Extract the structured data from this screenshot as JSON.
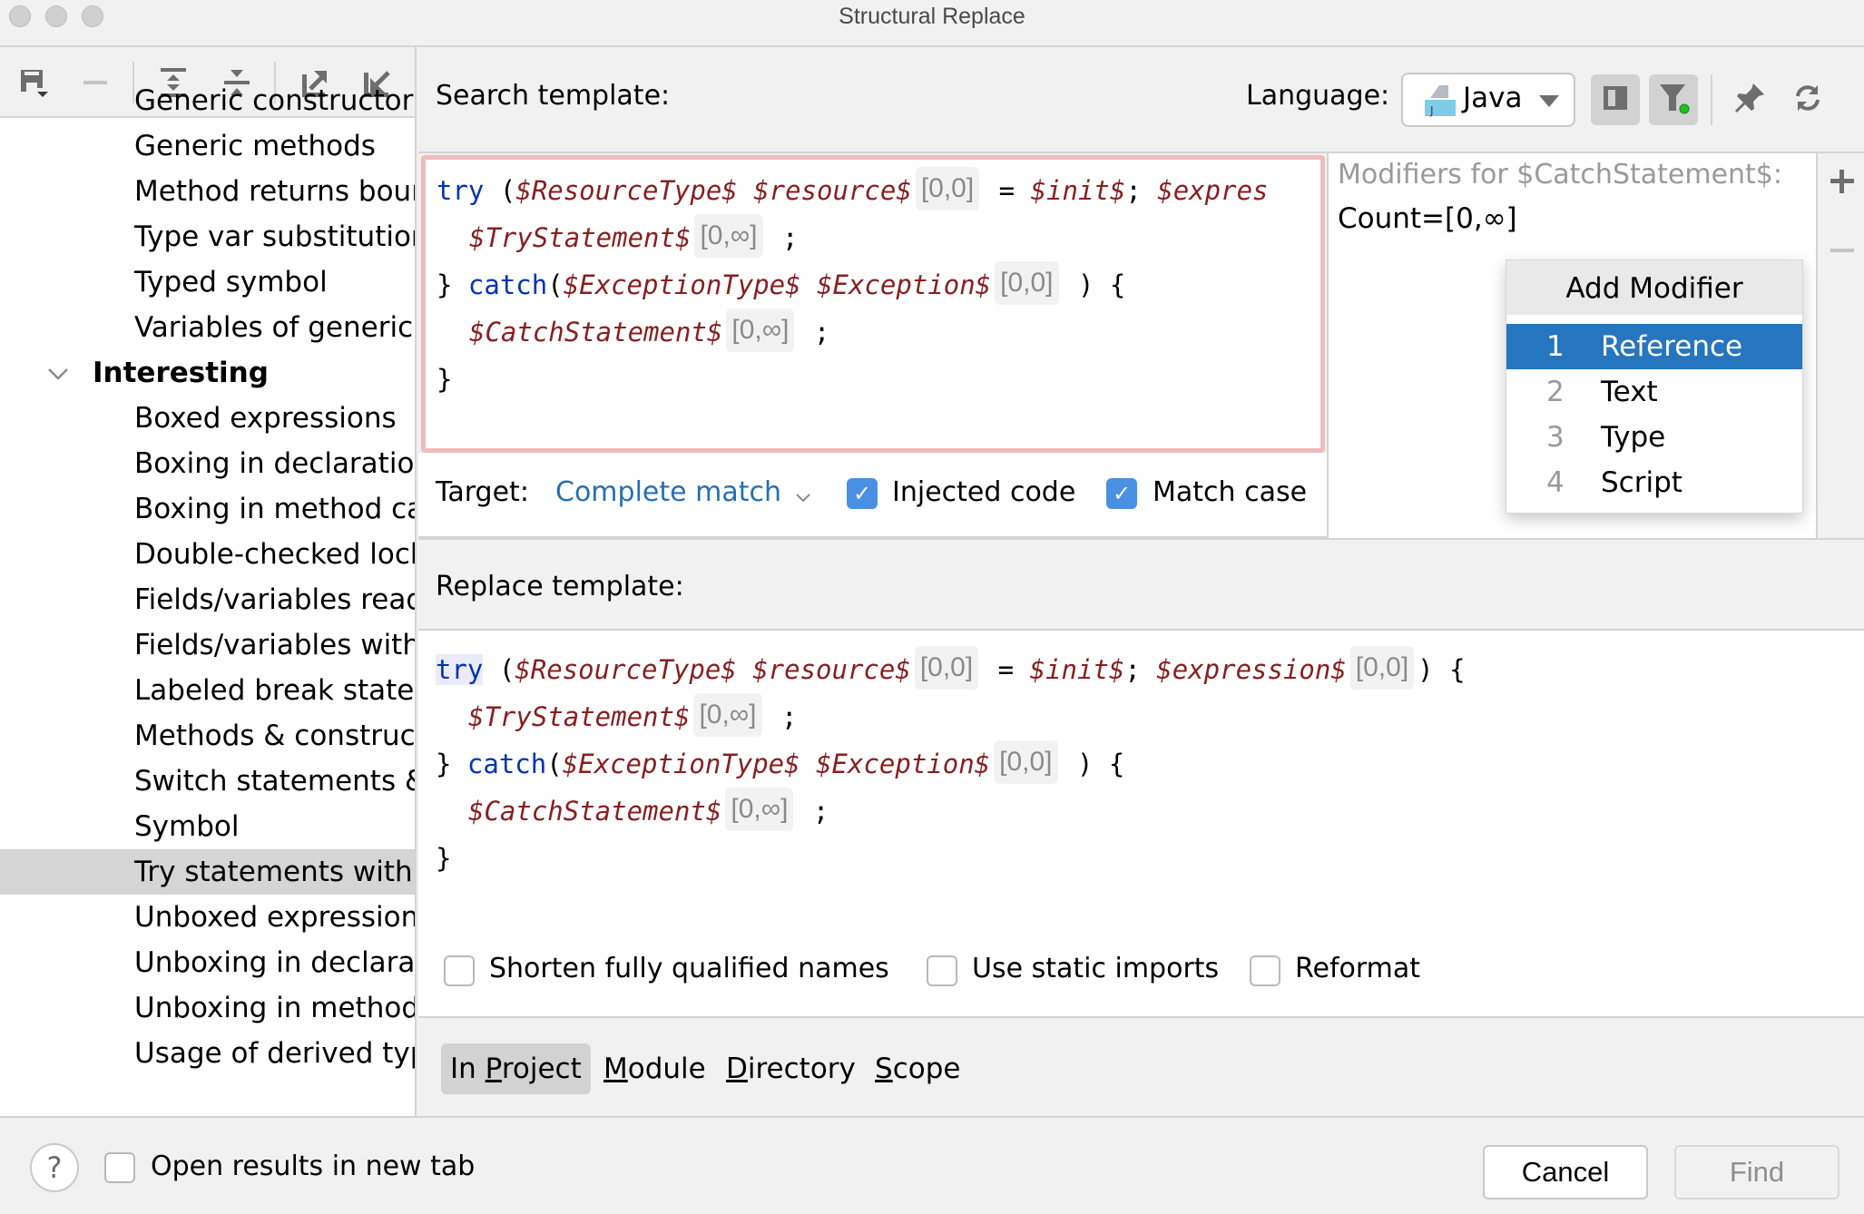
{
  "window": {
    "title": "Structural Replace"
  },
  "sidebar": {
    "toolbar": [
      {
        "name": "save-template-icon",
        "label": "Save template"
      },
      {
        "name": "remove-icon",
        "label": "Remove"
      },
      {
        "name": "expand-all-icon",
        "label": "Expand all"
      },
      {
        "name": "collapse-all-icon",
        "label": "Collapse all"
      },
      {
        "name": "export-icon",
        "label": "Export"
      },
      {
        "name": "import-icon",
        "label": "Import"
      }
    ],
    "items": [
      {
        "label": "Generic constructors",
        "type": "item"
      },
      {
        "label": "Generic methods",
        "type": "item"
      },
      {
        "label": "Method returns bounded wildcard",
        "type": "item"
      },
      {
        "label": "Type var substitutions",
        "type": "item"
      },
      {
        "label": "Typed symbol",
        "type": "item"
      },
      {
        "label": "Variables of generic types",
        "type": "item"
      },
      {
        "label": "Interesting",
        "type": "group",
        "expanded": true
      },
      {
        "label": "Boxed expressions",
        "type": "item"
      },
      {
        "label": "Boxing in declarations",
        "type": "item"
      },
      {
        "label": "Boxing in method calls",
        "type": "item"
      },
      {
        "label": "Double-checked locking",
        "type": "item"
      },
      {
        "label": "Fields/variables read",
        "type": "item"
      },
      {
        "label": "Fields/variables with",
        "type": "item"
      },
      {
        "label": "Labeled break statements",
        "type": "item"
      },
      {
        "label": "Methods & constructors",
        "type": "item"
      },
      {
        "label": "Switch statements &",
        "type": "item"
      },
      {
        "label": "Symbol",
        "type": "item"
      },
      {
        "label": "Try statements with",
        "type": "item",
        "selected": true
      },
      {
        "label": "Unboxed expressions",
        "type": "item"
      },
      {
        "label": "Unboxing in declarations",
        "type": "item"
      },
      {
        "label": "Unboxing in method calls",
        "type": "item"
      },
      {
        "label": "Usage of derived types",
        "type": "item"
      }
    ]
  },
  "search": {
    "header_label": "Search template:",
    "language_label": "Language:",
    "language_value": "Java",
    "language_icon": "java-file-icon",
    "tools": [
      {
        "name": "toggle-panel-icon",
        "active": true
      },
      {
        "name": "filter-icon",
        "active": true,
        "indicator_color": "#22c022"
      },
      {
        "name": "pin-icon",
        "active": false
      },
      {
        "name": "refresh-icon",
        "active": false
      }
    ],
    "code": {
      "line1": {
        "kw": "try",
        "p1": " (",
        "v1": "$ResourceType$",
        "v2": " $resource$",
        "c1": "[0,0]",
        "p2": " = ",
        "v3": "$init$",
        "p3": "; ",
        "v4": "$expres"
      },
      "line2": {
        "v1": "$TryStatement$",
        "c1": "[0,∞]",
        "p1": " ;"
      },
      "line3": {
        "p0": "} ",
        "kw": "catch",
        "p1": "(",
        "v1": "$ExceptionType$",
        "v2": " $Exception$",
        "c1": "[0,0]",
        "p2": " ) {"
      },
      "line4": {
        "v1": "$CatchStatement$",
        "c1": "[0,∞]",
        "p1": " ;"
      },
      "line5": {
        "p0": "}"
      }
    },
    "target_label": "Target:",
    "target_value": "Complete match",
    "injected_code": {
      "label": "Injected code",
      "checked": true
    },
    "match_case": {
      "label": "Match case",
      "checked": true
    }
  },
  "modifiers": {
    "title": "Modifiers for $CatchStatement$:",
    "count": "Count=[0,∞]",
    "add_label": "+",
    "remove_label": "−",
    "popup": {
      "title": "Add Modifier",
      "items": [
        {
          "num": "1",
          "label": "Reference",
          "selected": true
        },
        {
          "num": "2",
          "label": "Text"
        },
        {
          "num": "3",
          "label": "Type"
        },
        {
          "num": "4",
          "label": "Script"
        }
      ]
    }
  },
  "replace": {
    "header_label": "Replace template:",
    "code": {
      "line1": {
        "kw": "try",
        "p1": " (",
        "v1": "$ResourceType$",
        "v2": " $resource$",
        "c1": "[0,0]",
        "p2": " = ",
        "v3": "$init$",
        "p3": "; ",
        "v4": "$expression$",
        "c2": "[0,0]",
        "p4": ") {"
      },
      "line2": {
        "v1": "$TryStatement$",
        "c1": "[0,∞]",
        "p1": " ;"
      },
      "line3": {
        "p0": "} ",
        "kw": "catch",
        "p1": "(",
        "v1": "$ExceptionType$",
        "v2": " $Exception$",
        "c1": "[0,0]",
        "p2": " ) {"
      },
      "line4": {
        "v1": "$CatchStatement$",
        "c1": "[0,∞]",
        "p1": " ;"
      },
      "line5": {
        "p0": "}"
      }
    },
    "options": [
      {
        "label": "Shorten fully qualified names",
        "checked": false
      },
      {
        "label": "Use static imports",
        "checked": false
      },
      {
        "label": "Reformat",
        "checked": false
      }
    ]
  },
  "scope": {
    "items": [
      {
        "pre": "In ",
        "mn": "P",
        "post": "roject",
        "selected": true
      },
      {
        "pre": "",
        "mn": "M",
        "post": "odule"
      },
      {
        "pre": "",
        "mn": "D",
        "post": "irectory"
      },
      {
        "pre": "",
        "mn": "S",
        "post": "cope"
      }
    ]
  },
  "footer": {
    "help_label": "?",
    "open_in_new_tab": {
      "label": "Open results in new tab",
      "checked": false
    },
    "cancel_label": "Cancel",
    "find_label": "Find",
    "find_enabled": false
  },
  "colors": {
    "keyword": "#0033b3",
    "variable": "#871f1f",
    "selection": "#2675bf",
    "checkbox": "#4a90e2",
    "link": "#2470b3",
    "error_border": "#edbcbc"
  }
}
